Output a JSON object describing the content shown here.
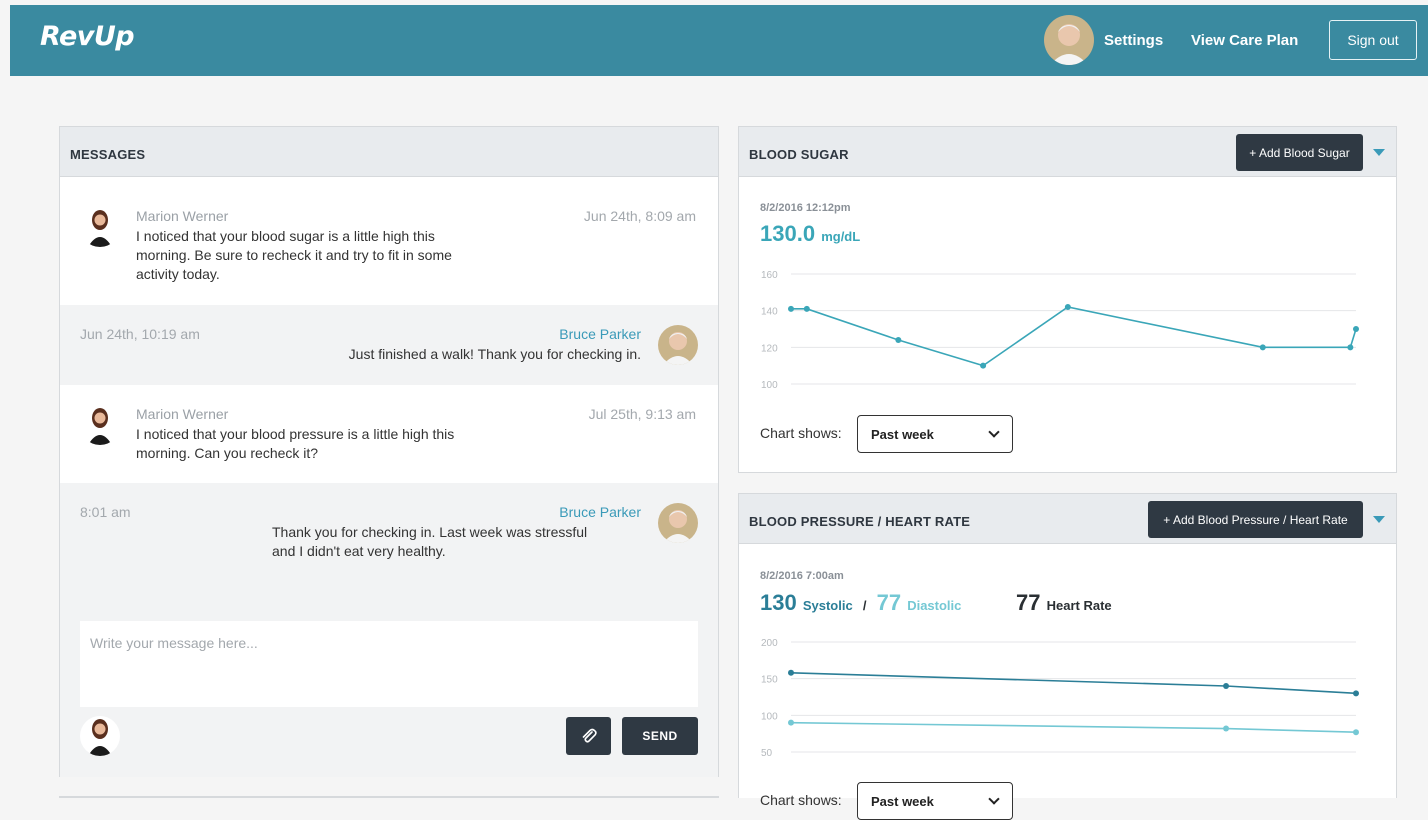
{
  "header": {
    "logo": "RevUp",
    "settings_label": "Settings",
    "care_plan_label": "View Care Plan",
    "signout_label": "Sign out",
    "bg_color": "#3a8aa0"
  },
  "messages": {
    "title": "MESSAGES",
    "items": [
      {
        "sender": "Marion Werner",
        "time": "Jun 24th, 8:09 am",
        "body_lines": [
          "I noticed that your blood sugar is a little high this",
          "morning. Be sure to recheck it and try to fit in some",
          "activity today."
        ]
      },
      {
        "sender": "Bruce Parker",
        "time": "Jun 24th, 10:19 am",
        "body_lines": [
          "Just finished a walk! Thank you for checking in."
        ]
      },
      {
        "sender": "Marion Werner",
        "time": "Jul 25th, 9:13 am",
        "body_lines": [
          "I noticed that your blood pressure is a little high this",
          "morning. Can you recheck it?"
        ]
      },
      {
        "sender": "Bruce Parker",
        "time": "8:01 am",
        "body_lines": [
          "Thank you for checking in. Last week was stressful",
          "and I didn't eat very healthy."
        ]
      }
    ],
    "compose_placeholder": "Write your message here...",
    "send_label": "SEND",
    "attach_icon": "paperclip-icon"
  },
  "blood_sugar": {
    "title": "BLOOD SUGAR",
    "add_label": "+ Add Blood Sugar",
    "reading_date": "8/2/2016  12:12pm",
    "value": "130.0",
    "unit": "mg/dL",
    "chart_shows_label": "Chart shows:",
    "range_selected": "Past week",
    "chart_data": {
      "type": "line",
      "ylim": [
        100,
        160
      ],
      "y_ticks": [
        "160",
        "140",
        "120",
        "100"
      ],
      "grid": true,
      "series": [
        {
          "values": [
            141,
            141,
            124,
            110,
            142,
            120,
            120,
            130
          ]
        }
      ],
      "color": "#3aa6b8"
    }
  },
  "bp": {
    "title": "BLOOD PRESSURE / HEART RATE",
    "add_label": "+ Add Blood Pressure / Heart Rate",
    "reading_date": "8/2/2016  7:00am",
    "systolic": "130",
    "systolic_label": "Systolic",
    "separator": "/",
    "diastolic": "77",
    "diastolic_label": "Diastolic",
    "heart_rate": "77",
    "heart_rate_label": "Heart Rate",
    "chart_shows_label": "Chart shows:",
    "range_selected": "Past week",
    "chart_data": {
      "type": "line",
      "ylim": [
        50,
        200
      ],
      "y_ticks": [
        "200",
        "150",
        "100",
        "50"
      ],
      "grid": true,
      "series": [
        {
          "values": [
            158,
            140,
            130
          ],
          "color": "#2b7e97"
        },
        {
          "values": [
            90,
            82,
            77
          ],
          "color": "#74c8d4"
        }
      ]
    }
  }
}
